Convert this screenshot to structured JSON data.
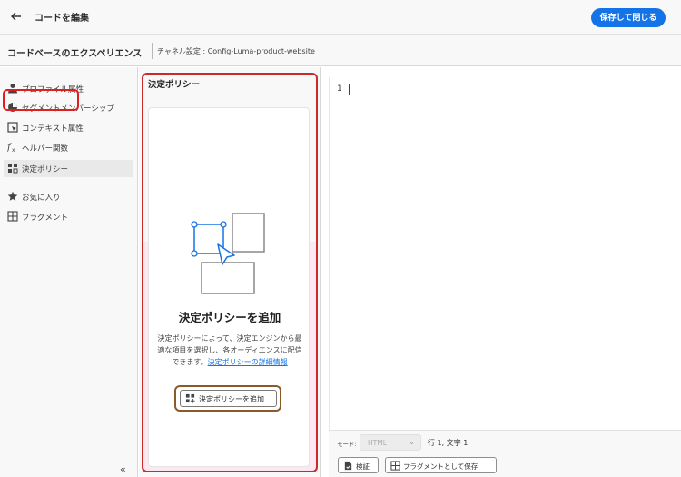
{
  "header": {
    "title": "コードを編集",
    "save_label": "保存して閉じる"
  },
  "subheader": {
    "experience": "コードベースのエクスペリエンス",
    "channel": "チャネル設定 : Config-Luma-product-website"
  },
  "sidebar": {
    "items": [
      {
        "label": "プロファイル属性",
        "icon": "user-icon"
      },
      {
        "label": "セグメントメンバーシップ",
        "icon": "segment-icon"
      },
      {
        "label": "コンテキスト属性",
        "icon": "context-icon"
      },
      {
        "label": "ヘルパー関数",
        "icon": "function-icon"
      },
      {
        "label": "決定ポリシー",
        "icon": "decision-policy-icon"
      },
      {
        "label": "お気に入り",
        "icon": "star-icon"
      },
      {
        "label": "フラグメント",
        "icon": "fragment-icon"
      }
    ],
    "collapse_label": "«"
  },
  "panel": {
    "title": "決定ポリシー",
    "heading": "決定ポリシーを追加",
    "description": "決定ポリシーによって、決定エンジンから最適な項目を選択し、各オーディエンスに配信できます。",
    "link_label": "決定ポリシーの詳細情報",
    "add_button_label": "決定ポリシーを追加"
  },
  "editor": {
    "line_number": "1"
  },
  "statusbar": {
    "mode_label": "モード:",
    "mode_value": "HTML",
    "position": "行 1, 文字 1"
  },
  "toolbar": {
    "validate_label": "検証",
    "save_fragment_label": "フラグメントとして保存"
  },
  "colors": {
    "accent": "#1473e6",
    "highlight": "#e01e1e"
  }
}
